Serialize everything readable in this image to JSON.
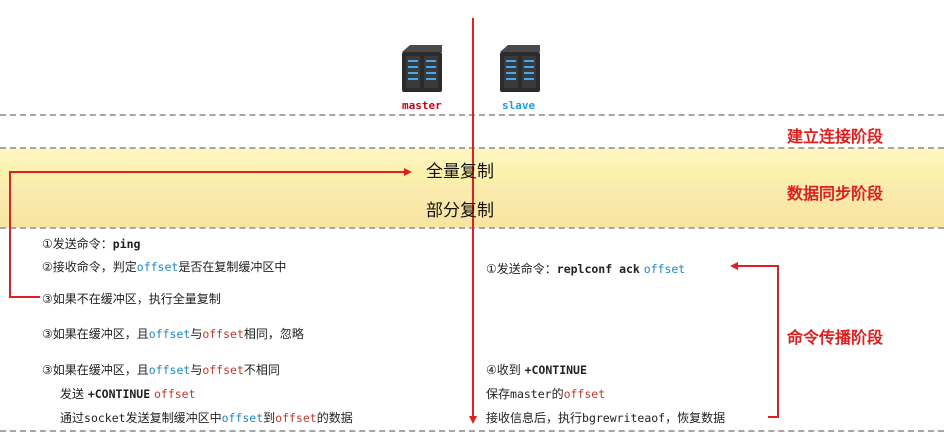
{
  "servers": {
    "master_label": "master",
    "slave_label": "slave"
  },
  "phases": {
    "connect": "建立连接阶段",
    "sync": "数据同步阶段",
    "propagate": "命令传播阶段"
  },
  "sync": {
    "full": "全量复制",
    "partial": "部分复制"
  },
  "left": {
    "l1_prefix": "①发送命令：",
    "l1_cmd": "ping",
    "l2_prefix": "②接收命令，判定",
    "l2_offset": "offset",
    "l2_suffix": "是否在复制缓冲区中",
    "l3": "③如果不在缓冲区，执行全量复制",
    "l4_prefix": "③如果在缓冲区，且",
    "l4_offset_a": "offset",
    "l4_mid": "与",
    "l4_offset_b": "offset",
    "l4_suffix": "相同，忽略",
    "l5_prefix": "③如果在缓冲区，且",
    "l5_offset_a": "offset",
    "l5_mid": "与",
    "l5_offset_b": "offset",
    "l5_suffix": "不相同",
    "l6_prefix": "发送 ",
    "l6_cmd": "+CONTINUE",
    "l6_offset": "offset",
    "l7_prefix": "通过",
    "l7_socket": "socket",
    "l7_mid": "发送复制缓冲区中",
    "l7_offset_a": "offset",
    "l7_to": "到",
    "l7_offset_b": "offset",
    "l7_suffix": "的数据"
  },
  "right": {
    "r1_prefix": "①发送命令：",
    "r1_cmd": "replconf ack",
    "r1_offset": "offset",
    "r2_prefix": "④收到 ",
    "r2_cmd": "+CONTINUE",
    "r3_prefix": "保存",
    "r3_master": "master",
    "r3_mid": "的",
    "r3_offset": "offset",
    "r4_prefix": "接收信息后，执行",
    "r4_cmd": "bgrewriteaof",
    "r4_suffix": "，恢复数据"
  },
  "colors": {
    "arrow": "#e02020",
    "offset_blue": "#1e88c8",
    "offset_red": "#c0392b",
    "phase": "#e02020"
  },
  "icons": {
    "master": "server-rack-icon",
    "slave": "server-rack-icon"
  }
}
